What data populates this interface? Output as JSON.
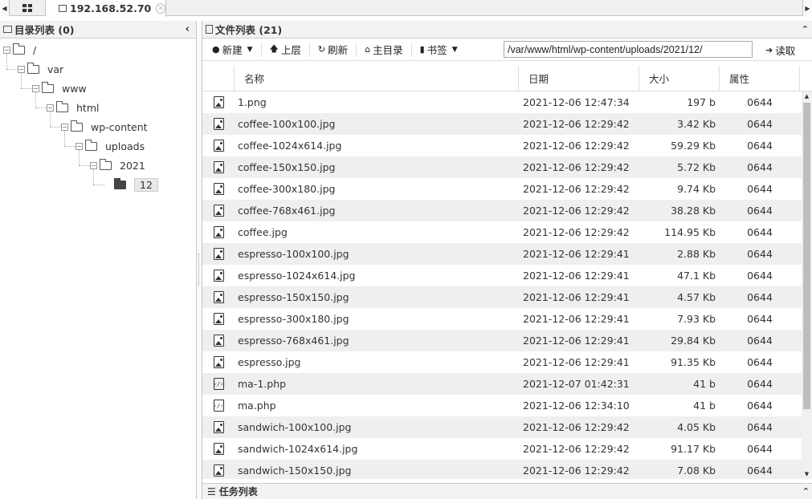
{
  "tabs": {
    "host": "192.168.52.70"
  },
  "left_panel": {
    "title": "目录列表 (0)",
    "tree": [
      {
        "label": "/",
        "level": 0
      },
      {
        "label": "var",
        "level": 1
      },
      {
        "label": "www",
        "level": 2
      },
      {
        "label": "html",
        "level": 3
      },
      {
        "label": "wp-content",
        "level": 4
      },
      {
        "label": "uploads",
        "level": 5
      },
      {
        "label": "2021",
        "level": 6
      },
      {
        "label": "12",
        "level": 7,
        "selected": true
      }
    ]
  },
  "right_panel": {
    "title": "文件列表 (21)",
    "toolbar": {
      "new": "新建",
      "up": "上层",
      "refresh": "刷新",
      "home": "主目录",
      "bookmark": "书签",
      "path": "/var/www/html/wp-content/uploads/2021/12/",
      "read": "读取"
    },
    "columns": {
      "name": "名称",
      "date": "日期",
      "size": "大小",
      "attr": "属性"
    },
    "files": [
      {
        "icon": "image-file-icon",
        "name": "1.png",
        "date": "2021-12-06 12:47:34",
        "size": "197 b",
        "attr": "0644"
      },
      {
        "icon": "image-file-icon",
        "name": "coffee-100x100.jpg",
        "date": "2021-12-06 12:29:42",
        "size": "3.42 Kb",
        "attr": "0644"
      },
      {
        "icon": "image-file-icon",
        "name": "coffee-1024x614.jpg",
        "date": "2021-12-06 12:29:42",
        "size": "59.29 Kb",
        "attr": "0644"
      },
      {
        "icon": "image-file-icon",
        "name": "coffee-150x150.jpg",
        "date": "2021-12-06 12:29:42",
        "size": "5.72 Kb",
        "attr": "0644"
      },
      {
        "icon": "image-file-icon",
        "name": "coffee-300x180.jpg",
        "date": "2021-12-06 12:29:42",
        "size": "9.74 Kb",
        "attr": "0644"
      },
      {
        "icon": "image-file-icon",
        "name": "coffee-768x461.jpg",
        "date": "2021-12-06 12:29:42",
        "size": "38.28 Kb",
        "attr": "0644"
      },
      {
        "icon": "image-file-icon",
        "name": "coffee.jpg",
        "date": "2021-12-06 12:29:42",
        "size": "114.95 Kb",
        "attr": "0644"
      },
      {
        "icon": "image-file-icon",
        "name": "espresso-100x100.jpg",
        "date": "2021-12-06 12:29:41",
        "size": "2.88 Kb",
        "attr": "0644"
      },
      {
        "icon": "image-file-icon",
        "name": "espresso-1024x614.jpg",
        "date": "2021-12-06 12:29:41",
        "size": "47.1 Kb",
        "attr": "0644"
      },
      {
        "icon": "image-file-icon",
        "name": "espresso-150x150.jpg",
        "date": "2021-12-06 12:29:41",
        "size": "4.57 Kb",
        "attr": "0644"
      },
      {
        "icon": "image-file-icon",
        "name": "espresso-300x180.jpg",
        "date": "2021-12-06 12:29:41",
        "size": "7.93 Kb",
        "attr": "0644"
      },
      {
        "icon": "image-file-icon",
        "name": "espresso-768x461.jpg",
        "date": "2021-12-06 12:29:41",
        "size": "29.84 Kb",
        "attr": "0644"
      },
      {
        "icon": "image-file-icon",
        "name": "espresso.jpg",
        "date": "2021-12-06 12:29:41",
        "size": "91.35 Kb",
        "attr": "0644"
      },
      {
        "icon": "code-file-icon",
        "name": "ma-1.php",
        "date": "2021-12-07 01:42:31",
        "size": "41 b",
        "attr": "0644"
      },
      {
        "icon": "code-file-icon",
        "name": "ma.php",
        "date": "2021-12-06 12:34:10",
        "size": "41 b",
        "attr": "0644"
      },
      {
        "icon": "image-file-icon",
        "name": "sandwich-100x100.jpg",
        "date": "2021-12-06 12:29:42",
        "size": "4.05 Kb",
        "attr": "0644"
      },
      {
        "icon": "image-file-icon",
        "name": "sandwich-1024x614.jpg",
        "date": "2021-12-06 12:29:42",
        "size": "91.17 Kb",
        "attr": "0644"
      },
      {
        "icon": "image-file-icon",
        "name": "sandwich-150x150.jpg",
        "date": "2021-12-06 12:29:42",
        "size": "7.08 Kb",
        "attr": "0644"
      }
    ]
  },
  "task_panel": {
    "title": "任务列表"
  }
}
